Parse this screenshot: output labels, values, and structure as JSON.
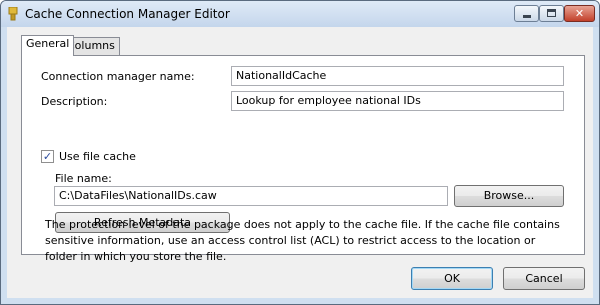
{
  "window": {
    "title": "Cache Connection Manager Editor",
    "close_glyph": "✕"
  },
  "tabs": [
    {
      "label": "General"
    },
    {
      "label": "Columns"
    }
  ],
  "general": {
    "connection_name_label": "Connection manager name:",
    "connection_name_value": "NationalIdCache",
    "description_label": "Description:",
    "description_value": "Lookup for employee national IDs",
    "use_file_cache_label": "Use file cache",
    "use_file_cache_checked_glyph": "✓",
    "file_name_label": "File name:",
    "file_name_value": "C:\\DataFiles\\NationalIDs.caw",
    "browse_label": "Browse...",
    "refresh_label": "Refresh Metadata",
    "note": "The protection level of the package does not apply to the cache file. If the cache file contains sensitive information, use an access control list (ACL) to restrict access to the location or folder in which you store the file."
  },
  "footer": {
    "ok_label": "OK",
    "cancel_label": "Cancel"
  },
  "icons": {
    "app": "app-icon",
    "minimize": "minimize-icon",
    "maximize": "maximize-icon",
    "close": "close-icon",
    "check": "checkmark-icon"
  },
  "colors": {
    "titlebar": "#cfdff0",
    "close_button": "#c2402a",
    "default_button_border": "#3c7fb1"
  }
}
